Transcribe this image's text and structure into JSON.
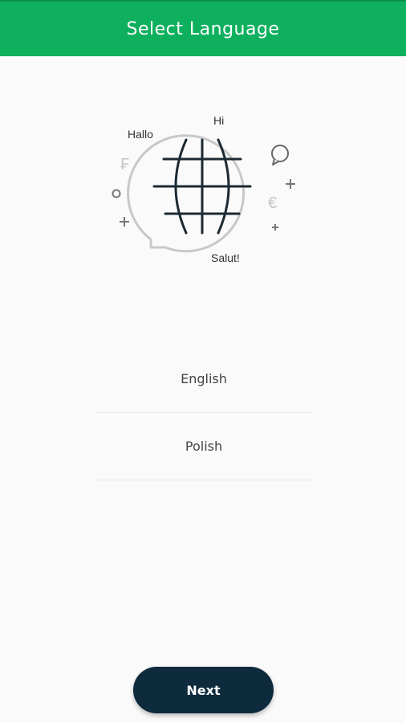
{
  "header": {
    "title": "Select Language"
  },
  "illustration": {
    "greetings": {
      "hallo": "Hallo",
      "hi": "Hi",
      "salut": "Salut!"
    },
    "icons": [
      "globe-speech-bubble-icon",
      "franc-icon",
      "euro-icon",
      "chat-bubble-icon",
      "plus-icon",
      "circle-icon"
    ],
    "franc_symbol": "₣",
    "euro_symbol": "€"
  },
  "languages": [
    {
      "label": "English"
    },
    {
      "label": "Polish"
    }
  ],
  "footer": {
    "next_label": "Next"
  },
  "colors": {
    "header_bg": "#0eb05e",
    "button_bg": "#0e2a3d",
    "background": "#fafafa"
  }
}
